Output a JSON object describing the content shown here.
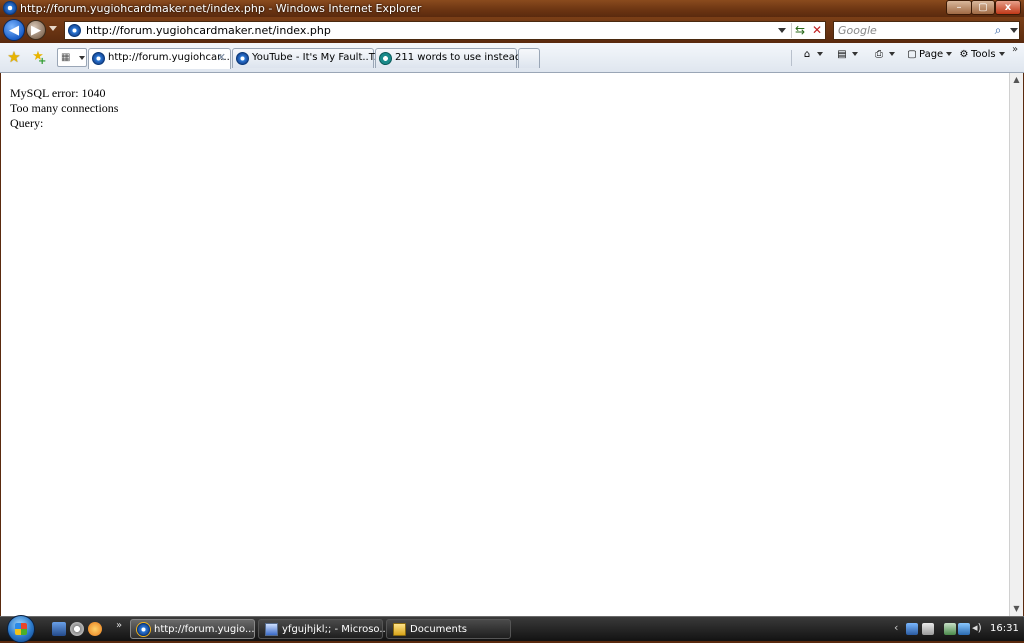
{
  "window": {
    "title": "http://forum.yugiohcardmaker.net/index.php - Windows Internet Explorer",
    "controls": {
      "minimize": "–",
      "maximize": "▢",
      "close": "x"
    }
  },
  "address_bar": {
    "url": "http://forum.yugiohcardmaker.net/index.php"
  },
  "search": {
    "placeholder": "Google"
  },
  "tabs": [
    {
      "label": "http://forum.yugiohcar...",
      "active": true,
      "icon": "ie-page-icon"
    },
    {
      "label": "YouTube - It's My Fault..T...",
      "active": false,
      "icon": "ie-page-icon"
    },
    {
      "label": "211 words to use instead o...",
      "active": false,
      "icon": "site-favicon"
    }
  ],
  "command_bar": {
    "page_label": "Page",
    "tools_label": "Tools"
  },
  "content": {
    "lines": [
      "MySQL error: 1040",
      "Too many connections",
      "Query:"
    ]
  },
  "taskbar": {
    "buttons": [
      {
        "label": "http://forum.yugio...",
        "icon": "ie-icon",
        "active": true
      },
      {
        "label": "yfgujhjkl;; - Microso...",
        "icon": "word-icon",
        "active": false
      },
      {
        "label": "Documents",
        "icon": "folder-icon",
        "active": false
      }
    ],
    "clock": "16:31"
  }
}
